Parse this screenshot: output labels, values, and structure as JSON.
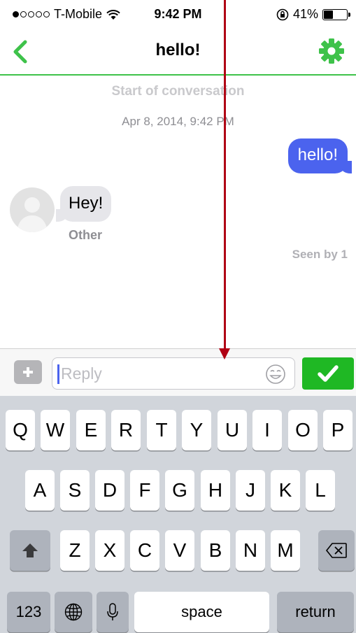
{
  "status_bar": {
    "carrier": "T-Mobile",
    "signal_bars_filled": 1,
    "signal_bars_total": 5,
    "time": "9:42 PM",
    "battery_percent": "41%",
    "battery_level": 0.41
  },
  "nav": {
    "title": "hello!",
    "back_icon": "chevron-left-icon",
    "settings_icon": "gear-icon",
    "accent_color": "#3ec24a"
  },
  "conversation": {
    "start_label": "Start of conversation",
    "date_label": "Apr 8, 2014, 9:42 PM",
    "messages": [
      {
        "direction": "outgoing",
        "text": "hello!",
        "color": "#4b63ee"
      },
      {
        "direction": "incoming",
        "text": "Hey!",
        "sender": "Other",
        "color": "#e6e6ea"
      }
    ],
    "seen_label": "Seen by 1"
  },
  "input": {
    "placeholder": "Reply",
    "plus_icon": "plus-icon",
    "emoji_icon": "smiley-icon",
    "send_icon": "check-icon",
    "send_color": "#1fb824"
  },
  "keyboard": {
    "row1": [
      "Q",
      "W",
      "E",
      "R",
      "T",
      "Y",
      "U",
      "I",
      "O",
      "P"
    ],
    "row2": [
      "A",
      "S",
      "D",
      "F",
      "G",
      "H",
      "J",
      "K",
      "L"
    ],
    "row3": [
      "Z",
      "X",
      "C",
      "V",
      "B",
      "N",
      "M"
    ],
    "numbers_key": "123",
    "space_key": "space",
    "return_key": "return",
    "shift_icon": "shift-icon",
    "delete_icon": "delete-icon",
    "globe_icon": "globe-icon",
    "mic_icon": "microphone-icon"
  }
}
